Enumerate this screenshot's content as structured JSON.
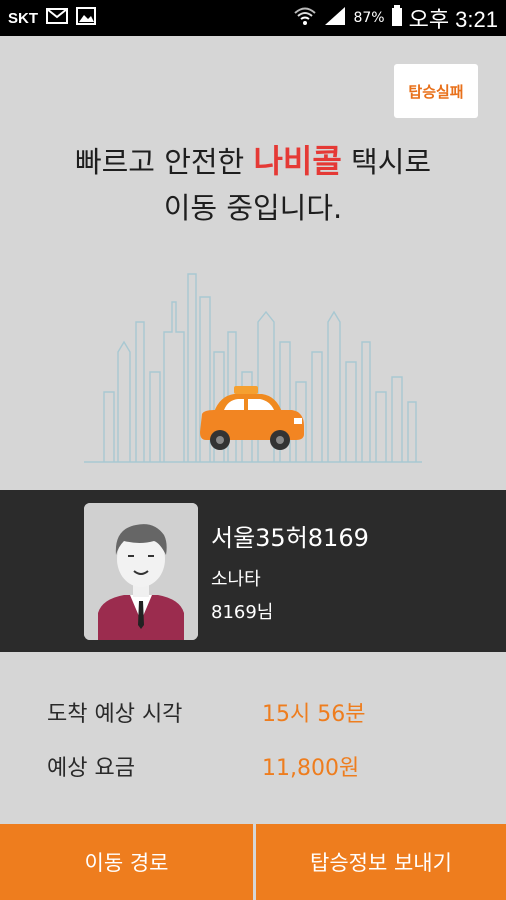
{
  "status_bar": {
    "carrier": "SKT",
    "battery": "87%",
    "time": "오후 3:21"
  },
  "top": {
    "fail_button": "탑승실패",
    "headline_pre": "빠르고 안전한 ",
    "brand": "나비콜",
    "headline_post": " 택시로",
    "headline_line2": "이동 중입니다."
  },
  "driver": {
    "plate": "서울35허8169",
    "car_model": "소나타",
    "driver_name": "8169님"
  },
  "info": {
    "eta_label": "도착 예상 시각",
    "eta_value": "15시 56분",
    "fare_label": "예상 요금",
    "fare_value": "11,800원"
  },
  "bottom": {
    "route_button": "이동 경로",
    "send_button": "탑승정보 보내기"
  },
  "colors": {
    "accent_orange": "#ee7d1e",
    "brand_red": "#e53935",
    "band_dark": "#2b2b2b",
    "background": "#d6d6d6"
  }
}
